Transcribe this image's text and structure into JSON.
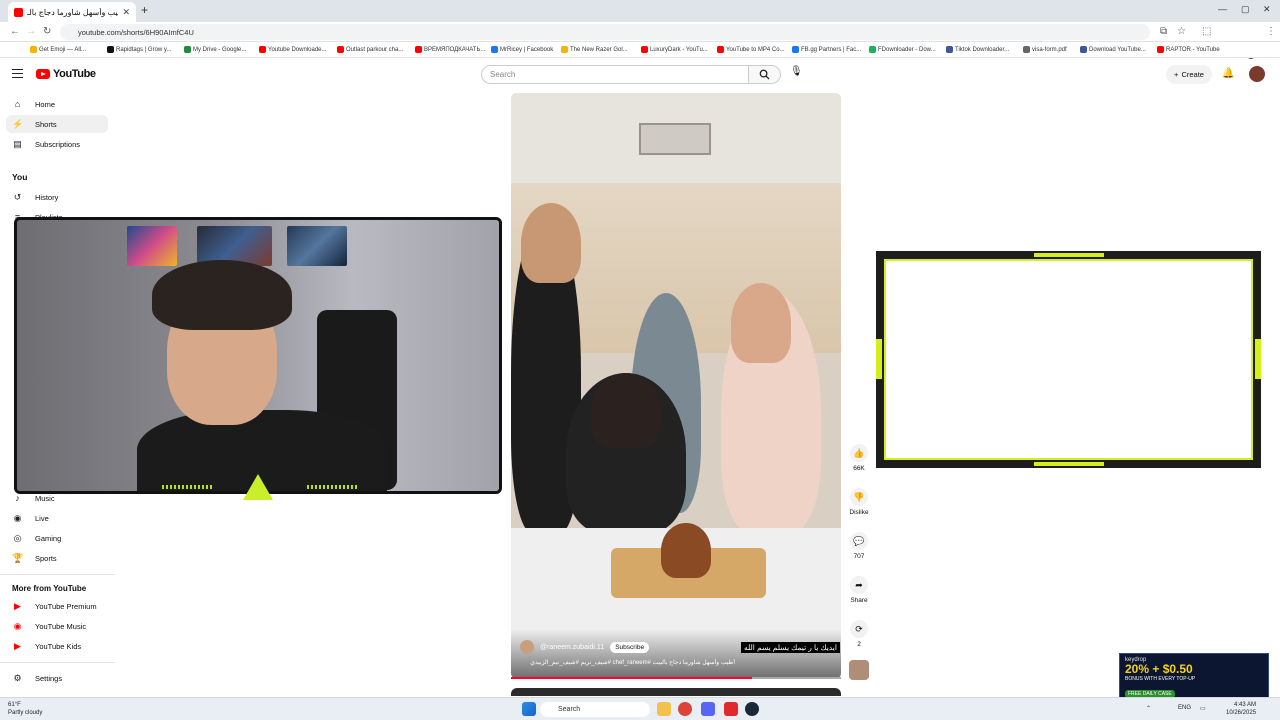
{
  "browser": {
    "tab_title": "أطيب وأسهل شاورما دجاج بالـ",
    "url": "youtube.com/shorts/6H90AImfC4U",
    "bookmarks": [
      {
        "label": "Get Emoji — All...",
        "color": "#f5b400"
      },
      {
        "label": "Rapidtags | Grow y...",
        "color": "#111111"
      },
      {
        "label": "My Drive - Google...",
        "color": "#1e8e3e"
      },
      {
        "label": "Youtube Downloade...",
        "color": "#ff0000"
      },
      {
        "label": "Outlast parkour cha...",
        "color": "#ff0000"
      },
      {
        "label": "ВРЕМЯПОДКАЧАТЬ...",
        "color": "#ff0000"
      },
      {
        "label": "MrRicey | Facebook",
        "color": "#1877f2"
      },
      {
        "label": "The New Razer Gol...",
        "color": "#f5b400"
      },
      {
        "label": "LuxuryDark - YouTu...",
        "color": "#ff0000"
      },
      {
        "label": "YouTube to MP4 Co...",
        "color": "#ff0000"
      },
      {
        "label": "FB.gg Partners | Fac...",
        "color": "#1877f2"
      },
      {
        "label": "FDownloader - Dow...",
        "color": "#19b35c"
      },
      {
        "label": "Tiktok Downloader...",
        "color": "#3b5998"
      },
      {
        "label": "visa-form.pdf",
        "color": "#666666"
      },
      {
        "label": "Download YouTube...",
        "color": "#3b5998"
      },
      {
        "label": "RAPTOR - YouTube",
        "color": "#ff0000"
      }
    ]
  },
  "youtube": {
    "logo_text": "YouTube",
    "search_placeholder": "Search",
    "create_label": "Create",
    "sidebar": {
      "top": [
        {
          "label": "Home",
          "icon": "home-icon"
        },
        {
          "label": "Shorts",
          "icon": "shorts-icon"
        },
        {
          "label": "Subscriptions",
          "icon": "subscriptions-icon"
        }
      ],
      "you_header": "You",
      "you": [
        {
          "label": "History",
          "icon": "history-icon"
        },
        {
          "label": "Playlists",
          "icon": "playlists-icon"
        }
      ],
      "explore": [
        {
          "label": "Music",
          "icon": "music-icon"
        },
        {
          "label": "Live",
          "icon": "live-icon"
        },
        {
          "label": "Gaming",
          "icon": "gaming-icon"
        },
        {
          "label": "Sports",
          "icon": "sports-icon"
        }
      ],
      "more_header": "More from YouTube",
      "more": [
        {
          "label": "YouTube Premium",
          "icon": "youtube-premium-icon"
        },
        {
          "label": "YouTube Music",
          "icon": "youtube-music-icon"
        },
        {
          "label": "YouTube Kids",
          "icon": "youtube-kids-icon"
        }
      ],
      "settings": "Settings"
    },
    "short": {
      "channel": "@raneem.zubaidi.11",
      "subscribe_label": "Subscribe",
      "caption": "أطيب وأسهل شاورما دجاج بالبيت #chef_raneem #شيف_نريم #شيف_نيم_الزبيدي",
      "overlay_text": "ايديك يا ر تيمك يسلم يسم الله",
      "progress": 0.73
    },
    "actions": {
      "likes": "66K",
      "dislike": "Dislike",
      "comments": "707",
      "share": "Share",
      "remix": "2"
    }
  },
  "ad": {
    "brand": "keydrop",
    "promo": "20% + $0.50",
    "sub": "BONUS WITH EVERY TOP-UP",
    "pill": "FREE DAILY CASE"
  },
  "taskbar": {
    "temp": "61°F",
    "weather": "Partly cloudy",
    "search": "Search",
    "lang": "ENG",
    "time": "4:43 AM",
    "date": "10/26/2025"
  }
}
